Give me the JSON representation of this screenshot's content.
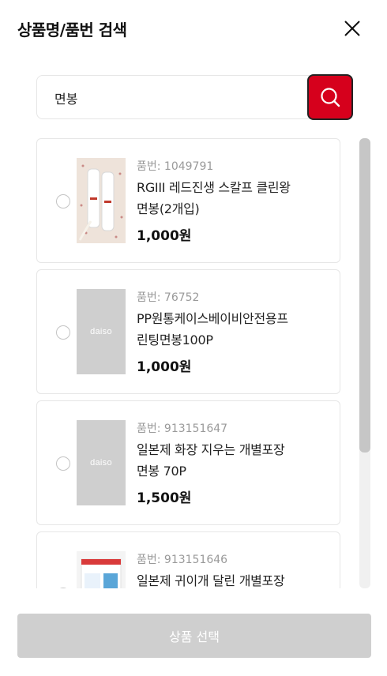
{
  "header": {
    "title": "상품명/품번 검색"
  },
  "search": {
    "value": "면봉",
    "icon": "search-icon",
    "accent": "#d6001c"
  },
  "products": [
    {
      "code": "품번: 1049791",
      "name_line1": "RGIII 레드진생 스칼프 클린왕",
      "name_line2": "면봉(2개입)",
      "price": "1,000원",
      "image": "product-photo"
    },
    {
      "code": "품번: 76752",
      "name_line1": "PP원통케이스베이비안전용프",
      "name_line2": "린팅면봉100P",
      "price": "1,000원",
      "image_text": "daiso"
    },
    {
      "code": "품번: 913151647",
      "name_line1": "일본제 화장 지우는 개별포장",
      "name_line2": "면봉 70P",
      "price": "1,500원",
      "image_text": "daiso"
    },
    {
      "code": "품번: 913151646",
      "name_line1": "일본제 귀이개 달린 개별포장",
      "name_line2": "",
      "price": "",
      "image": "product-photo"
    }
  ],
  "footer": {
    "submit_label": "상품 선택"
  }
}
